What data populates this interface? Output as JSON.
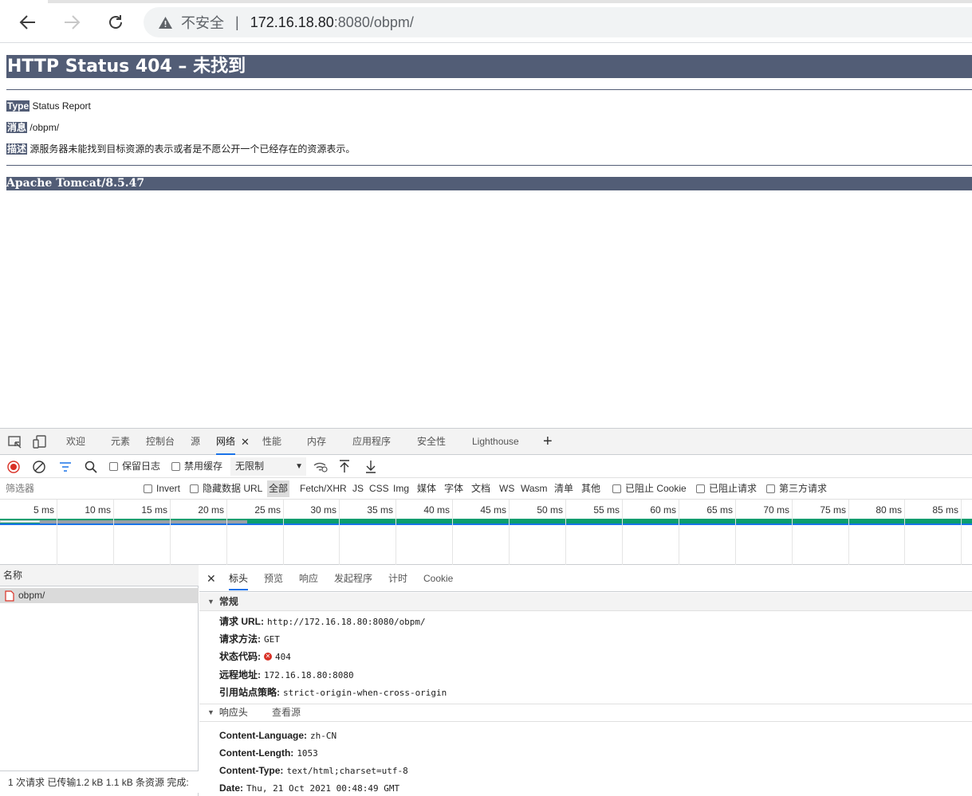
{
  "browser": {
    "insecure_label": "不安全",
    "separator": "|",
    "url_host": "172.16.18.80",
    "url_rest": ":8080/obpm/"
  },
  "page": {
    "heading": "HTTP Status 404 – 未找到",
    "type_label": "Type",
    "type_value": "Status Report",
    "message_label": "消息",
    "message_value": "/obpm/",
    "desc_label": "描述",
    "desc_value": "源服务器未能找到目标资源的表示或者是不愿公开一个已经存在的资源表示。",
    "footer": "Apache Tomcat/8.5.47"
  },
  "devtools": {
    "tabs": [
      "欢迎",
      "元素",
      "控制台",
      "源",
      "网络",
      "性能",
      "内存",
      "应用程序",
      "安全性",
      "Lighthouse"
    ],
    "active_tab": "网络",
    "toolbar": {
      "preserve_log": "保留日志",
      "disable_cache": "禁用缓存",
      "throttle": "无限制"
    },
    "filter": {
      "placeholder": "筛选器",
      "invert": "Invert",
      "hide_data_url": "隐藏数据 URL",
      "types": [
        "全部",
        "Fetch/XHR",
        "JS",
        "CSS",
        "Img",
        "媒体",
        "字体",
        "文档",
        "WS",
        "Wasm",
        "清单",
        "其他"
      ],
      "active_type": "全部",
      "blocked_cookies": "已阻止 Cookie",
      "blocked_requests": "已阻止请求",
      "third_party": "第三方请求"
    },
    "timeline_ticks": [
      "5 ms",
      "10 ms",
      "15 ms",
      "20 ms",
      "25 ms",
      "30 ms",
      "35 ms",
      "40 ms",
      "45 ms",
      "50 ms",
      "55 ms",
      "60 ms",
      "65 ms",
      "70 ms",
      "75 ms",
      "80 ms",
      "85 ms"
    ],
    "request_list": {
      "header": "名称",
      "rows": [
        "obpm/"
      ],
      "status": "1 次请求  已传输1.2 kB  1.1 kB 条资源  完成:"
    },
    "detail": {
      "tabs": [
        "标头",
        "预览",
        "响应",
        "发起程序",
        "计时",
        "Cookie"
      ],
      "active_tab": "标头",
      "general_title": "常规",
      "general": [
        {
          "k": "请求 URL:",
          "v": "http://172.16.18.80:8080/obpm/"
        },
        {
          "k": "请求方法:",
          "v": "GET"
        },
        {
          "k": "状态代码:",
          "v": "404"
        },
        {
          "k": "远程地址:",
          "v": "172.16.18.80:8080"
        },
        {
          "k": "引用站点策略:",
          "v": "strict-origin-when-cross-origin"
        }
      ],
      "response_headers_title": "响应头",
      "view_source": "查看源",
      "response_headers": [
        {
          "k": "Content-Language:",
          "v": "zh-CN"
        },
        {
          "k": "Content-Length:",
          "v": "1053"
        },
        {
          "k": "Content-Type:",
          "v": "text/html;charset=utf-8"
        },
        {
          "k": "Date:",
          "v": "Thu, 21 Oct 2021 00:48:49 GMT"
        }
      ]
    }
  },
  "colors": {
    "tomcat_bar": "#525d76",
    "accent": "#1a73e8",
    "error": "#d93025",
    "timeline_green": "#0a9e6f"
  }
}
